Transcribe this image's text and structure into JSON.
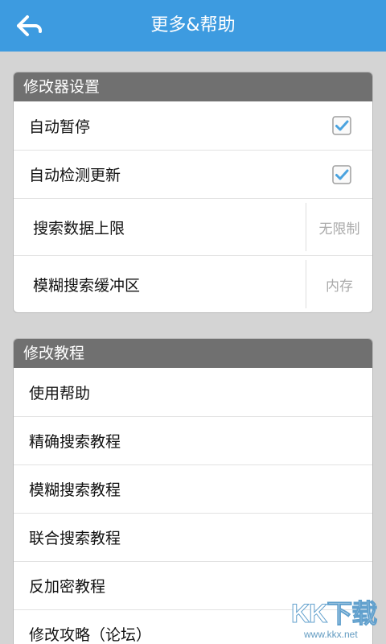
{
  "header": {
    "title": "更多&帮助",
    "back_icon": "arrow-left-icon"
  },
  "settings": {
    "title": "修改器设置",
    "items": [
      {
        "label": "自动暂停",
        "checked": true
      },
      {
        "label": "自动检测更新",
        "checked": true
      },
      {
        "label": "搜索数据上限",
        "value": "无限制"
      },
      {
        "label": "模糊搜索缓冲区",
        "value": "内存"
      }
    ]
  },
  "tutorials": {
    "title": "修改教程",
    "items": [
      {
        "label": "使用帮助"
      },
      {
        "label": "精确搜索教程"
      },
      {
        "label": "模糊搜索教程"
      },
      {
        "label": "联合搜索教程"
      },
      {
        "label": "反加密教程"
      },
      {
        "label": "修改攻略（论坛）"
      }
    ]
  },
  "watermark": {
    "logo": "KK下载",
    "url": "www.kkx.net"
  },
  "colors": {
    "header": "#3d9be0",
    "background": "#d4d4d4",
    "section_header": "#707070",
    "check": "#4aa3df"
  }
}
